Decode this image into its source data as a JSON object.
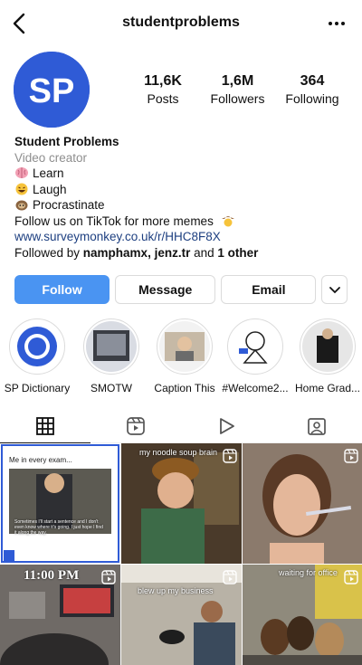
{
  "header": {
    "username": "studentproblems"
  },
  "profile": {
    "avatar_text": "SP",
    "stats": [
      {
        "value": "11,6K",
        "label": "Posts"
      },
      {
        "value": "1,6M",
        "label": "Followers"
      },
      {
        "value": "364",
        "label": "Following"
      }
    ],
    "name": "Student Problems",
    "category": "Video creator",
    "bio_lines": [
      {
        "emoji": "brain-icon",
        "text": "Learn"
      },
      {
        "emoji": "laughing-face-icon",
        "text": "Laugh"
      },
      {
        "emoji": "sloth-icon",
        "text": "Procrastinate"
      }
    ],
    "tiktok_line": "Follow us on TikTok for more memes",
    "link": "www.surveymonkey.co.uk/r/HHC8F8X",
    "followed_by_prefix": "Followed by ",
    "followed_by_users": "namphamx, jenz.tr",
    "followed_by_and": " and ",
    "followed_by_other": "1 other"
  },
  "actions": {
    "follow": "Follow",
    "message": "Message",
    "email": "Email"
  },
  "highlights": [
    {
      "label": "SP Dictionary"
    },
    {
      "label": "SMOTW"
    },
    {
      "label": "Caption This"
    },
    {
      "label": "#Welcome2..."
    },
    {
      "label": "Home Grad..."
    }
  ],
  "tabs": [
    "grid-icon",
    "reels-icon",
    "play-icon",
    "tagged-icon"
  ],
  "grid": {
    "post1_caption": "Me in every exam...",
    "post1_sub": "Sometimes I'll start a sentence and I don't even know where it's going. I just hope I find it along the way.",
    "post2_caption": "my noodle soup brain",
    "post4_caption": "11:00 PM",
    "post5_caption": "blew up my business",
    "post6_caption": "waiting for office"
  },
  "colors": {
    "accent": "#4a94f2",
    "brand": "#2f5bd6",
    "link": "#1d3f80"
  }
}
